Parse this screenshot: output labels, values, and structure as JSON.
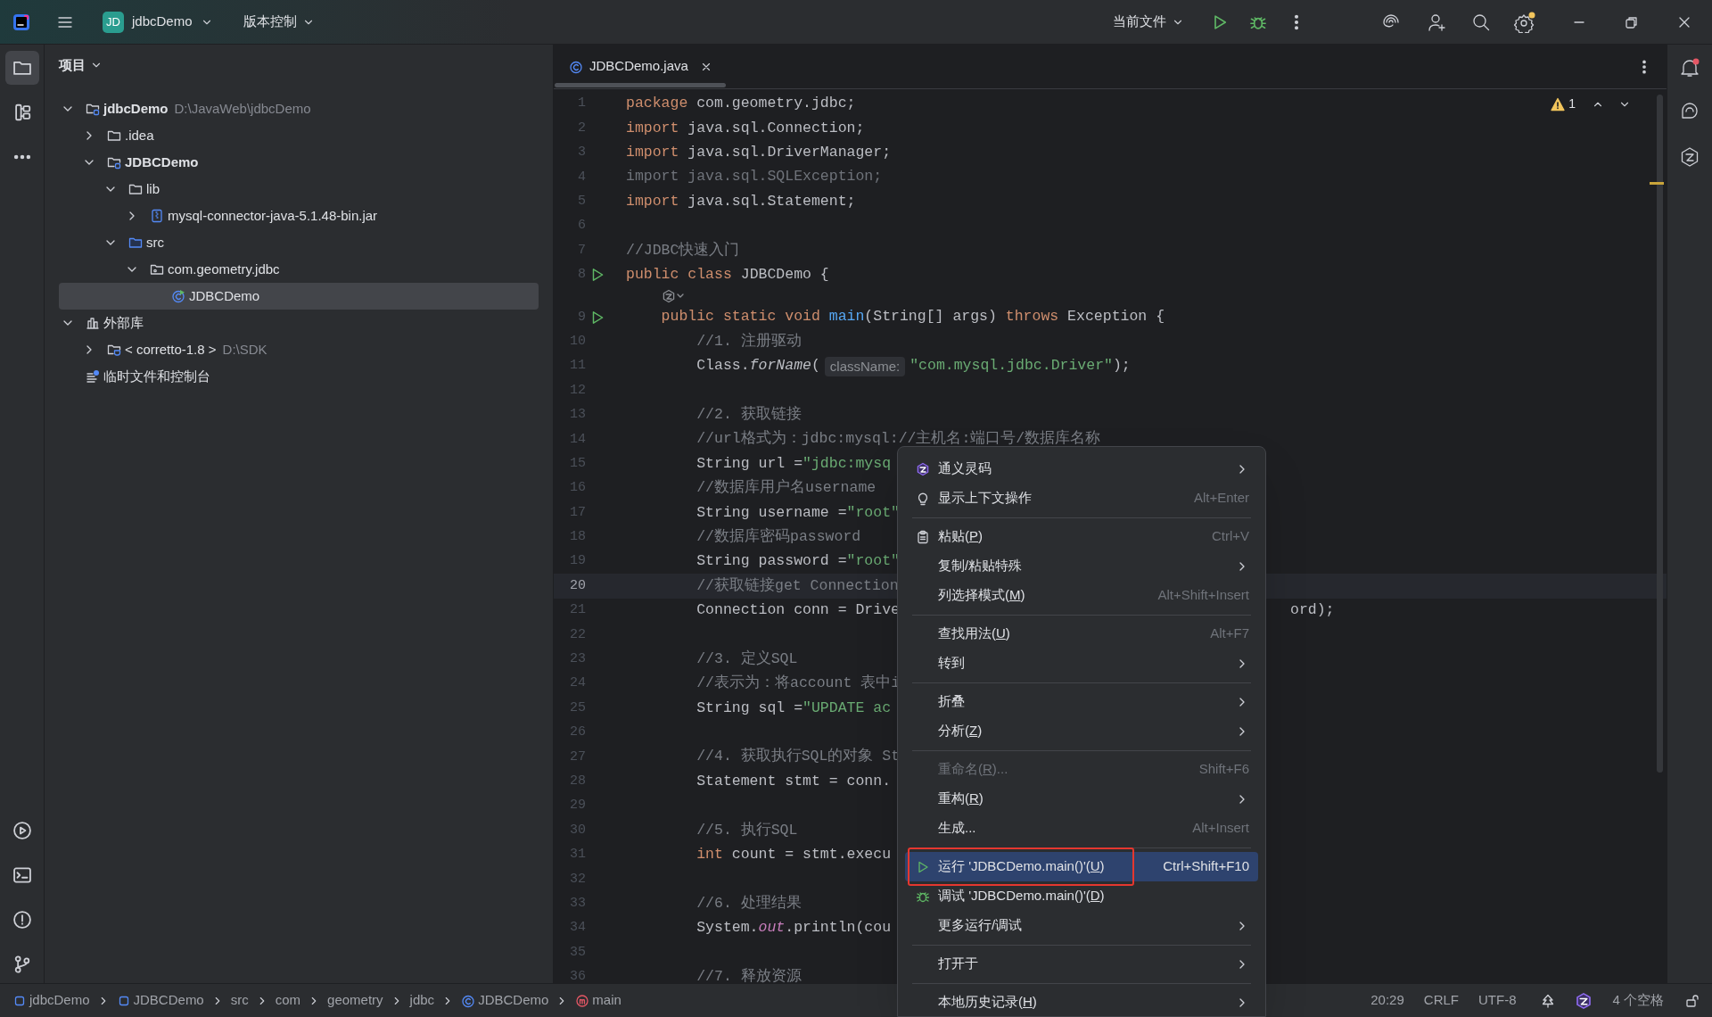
{
  "title_bar": {
    "project": {
      "badge": "JD",
      "name": "jdbcDemo"
    },
    "vcs": "版本控制",
    "run_config": "当前文件"
  },
  "left_toolbar": {
    "tools": [
      {
        "selected": true
      },
      {
        "selected": false
      }
    ]
  },
  "project_panel": {
    "title": "项目",
    "tree": [
      {
        "kind": "module",
        "label": "jdbcDemo",
        "hint": "D:\\JavaWeb\\jdbcDemo",
        "expanded": true,
        "selected": false,
        "children": [
          {
            "kind": "folder",
            "label": ".idea",
            "expanded": false,
            "selected": false
          },
          {
            "kind": "module",
            "label": "JDBCDemo",
            "expanded": true,
            "selected": false,
            "children": [
              {
                "kind": "folder",
                "label": "lib",
                "expanded": true,
                "selected": false,
                "children": [
                  {
                    "kind": "jar",
                    "label": "mysql-connector-java-5.1.48-bin.jar",
                    "expanded": false,
                    "selected": false
                  }
                ]
              },
              {
                "kind": "src",
                "label": "src",
                "expanded": true,
                "selected": false,
                "children": [
                  {
                    "kind": "package",
                    "label": "com.geometry.jdbc",
                    "expanded": true,
                    "selected": false,
                    "children": [
                      {
                        "kind": "class",
                        "label": "JDBCDemo",
                        "selected": true
                      }
                    ]
                  }
                ]
              }
            ]
          }
        ]
      },
      {
        "kind": "library",
        "label": "外部库",
        "expanded": true,
        "selected": false,
        "children": [
          {
            "kind": "sdk",
            "label": "< corretto-1.8 >",
            "hint": "D:\\SDK",
            "expanded": false,
            "selected": false
          }
        ]
      },
      {
        "kind": "scratch",
        "label": "临时文件和控制台",
        "selected": false
      }
    ]
  },
  "editor": {
    "tabs": [
      {
        "label": "JDBCDemo.java",
        "selected": true
      }
    ],
    "warnings": "1",
    "lines": [
      {
        "kind": "code",
        "number": "1",
        "current": false,
        "run": false,
        "tokens": [
          {
            "kind": "kw",
            "text": "package"
          },
          {
            "kind": "plain",
            "text": " com.geometry.jdbc;"
          }
        ]
      },
      {
        "kind": "code",
        "number": "2",
        "current": false,
        "run": false,
        "tokens": [
          {
            "kind": "kw",
            "text": "import"
          },
          {
            "kind": "plain",
            "text": " java.sql.Connection;"
          }
        ]
      },
      {
        "kind": "code",
        "number": "3",
        "current": false,
        "run": false,
        "tokens": [
          {
            "kind": "kw",
            "text": "import"
          },
          {
            "kind": "plain",
            "text": " java.sql.DriverManager;"
          }
        ]
      },
      {
        "kind": "code",
        "number": "4",
        "current": false,
        "run": false,
        "tokens": [
          {
            "kind": "unused",
            "text": "import java.sql.SQLException;"
          }
        ]
      },
      {
        "kind": "code",
        "number": "5",
        "current": false,
        "run": false,
        "tokens": [
          {
            "kind": "kw",
            "text": "import"
          },
          {
            "kind": "plain",
            "text": " java.sql.Statement;"
          }
        ]
      },
      {
        "kind": "code",
        "number": "6",
        "current": false,
        "run": false
      },
      {
        "kind": "code",
        "number": "7",
        "current": false,
        "run": false,
        "tokens": [
          {
            "kind": "comment",
            "text": "//JDBC快速入门"
          }
        ]
      },
      {
        "kind": "code",
        "number": "8",
        "current": false,
        "run": true,
        "tokens": [
          {
            "kind": "kw",
            "text": "public class"
          },
          {
            "kind": "plain",
            "text": " JDBCDemo {"
          }
        ]
      },
      {
        "kind": "inlay"
      },
      {
        "kind": "code",
        "number": "9",
        "current": false,
        "run": true,
        "tokens": [
          {
            "kind": "kw",
            "text": "    public static void "
          },
          {
            "kind": "fn",
            "text": "main"
          },
          {
            "kind": "plain",
            "text": "(String[] args) "
          },
          {
            "kind": "kw",
            "text": "throws"
          },
          {
            "kind": "plain",
            "text": " Exception {"
          }
        ]
      },
      {
        "kind": "code",
        "number": "10",
        "current": false,
        "run": false,
        "tokens": [
          {
            "kind": "comment",
            "text": "        //1. 注册驱动"
          }
        ]
      },
      {
        "kind": "code",
        "number": "11",
        "current": false,
        "run": false,
        "tokens": [
          {
            "kind": "plain",
            "text": "        Class."
          },
          {
            "kind": "static",
            "text": "forName"
          },
          {
            "kind": "plain",
            "text": "("
          },
          {
            "kind": "hint",
            "text": "className:"
          },
          {
            "kind": "str",
            "text": "\"com.mysql.jdbc.Driver\""
          },
          {
            "kind": "plain",
            "text": ");"
          }
        ]
      },
      {
        "kind": "code",
        "number": "12",
        "current": false,
        "run": false
      },
      {
        "kind": "code",
        "number": "13",
        "current": false,
        "run": false,
        "tokens": [
          {
            "kind": "comment",
            "text": "        //2. 获取链接"
          }
        ]
      },
      {
        "kind": "code",
        "number": "14",
        "current": false,
        "run": false,
        "tokens": [
          {
            "kind": "comment",
            "text": "        //url格式为：jdbc:mysql://主机名:端口号/数据库名称"
          }
        ]
      },
      {
        "kind": "code",
        "number": "15",
        "current": false,
        "run": false,
        "tokens": [
          {
            "kind": "plain",
            "text": "        String url ="
          },
          {
            "kind": "str",
            "text": "\"jdbc:mysq"
          }
        ]
      },
      {
        "kind": "code",
        "number": "16",
        "current": false,
        "run": false,
        "tokens": [
          {
            "kind": "comment",
            "text": "        //数据库用户名username"
          }
        ]
      },
      {
        "kind": "code",
        "number": "17",
        "current": false,
        "run": false,
        "tokens": [
          {
            "kind": "plain",
            "text": "        String username ="
          },
          {
            "kind": "str",
            "text": "\"root\""
          }
        ]
      },
      {
        "kind": "code",
        "number": "18",
        "current": false,
        "run": false,
        "tokens": [
          {
            "kind": "comment",
            "text": "        //数据库密码password"
          }
        ]
      },
      {
        "kind": "code",
        "number": "19",
        "current": false,
        "run": false,
        "tokens": [
          {
            "kind": "plain",
            "text": "        String password ="
          },
          {
            "kind": "str",
            "text": "\"root\""
          }
        ]
      },
      {
        "kind": "code",
        "number": "20",
        "current": true,
        "run": false,
        "tokens": [
          {
            "kind": "comment",
            "text": "        //获取链接get Connection"
          }
        ]
      },
      {
        "kind": "code",
        "number": "21",
        "current": false,
        "run": false,
        "tokens": [
          {
            "kind": "plain",
            "text": "        Connection conn = Drive"
          }
        ],
        "tail": "ord);"
      },
      {
        "kind": "code",
        "number": "22",
        "current": false,
        "run": false
      },
      {
        "kind": "code",
        "number": "23",
        "current": false,
        "run": false,
        "tokens": [
          {
            "kind": "comment",
            "text": "        //3. 定义SQL"
          }
        ]
      },
      {
        "kind": "code",
        "number": "24",
        "current": false,
        "run": false,
        "tokens": [
          {
            "kind": "comment",
            "text": "        //表示为：将account 表中i"
          }
        ]
      },
      {
        "kind": "code",
        "number": "25",
        "current": false,
        "run": false,
        "tokens": [
          {
            "kind": "plain",
            "text": "        String sql ="
          },
          {
            "kind": "str",
            "text": "\"UPDATE ac"
          }
        ]
      },
      {
        "kind": "code",
        "number": "26",
        "current": false,
        "run": false
      },
      {
        "kind": "code",
        "number": "27",
        "current": false,
        "run": false,
        "tokens": [
          {
            "kind": "comment",
            "text": "        //4. 获取执行SQL的对象 St"
          }
        ]
      },
      {
        "kind": "code",
        "number": "28",
        "current": false,
        "run": false,
        "tokens": [
          {
            "kind": "plain",
            "text": "        Statement stmt = conn."
          }
        ]
      },
      {
        "kind": "code",
        "number": "29",
        "current": false,
        "run": false
      },
      {
        "kind": "code",
        "number": "30",
        "current": false,
        "run": false,
        "tokens": [
          {
            "kind": "comment",
            "text": "        //5. 执行SQL"
          }
        ]
      },
      {
        "kind": "code",
        "number": "31",
        "current": false,
        "run": false,
        "tokens": [
          {
            "kind": "kw",
            "text": "        int"
          },
          {
            "kind": "plain",
            "text": " count = stmt.execu"
          }
        ]
      },
      {
        "kind": "code",
        "number": "32",
        "current": false,
        "run": false
      },
      {
        "kind": "code",
        "number": "33",
        "current": false,
        "run": false,
        "tokens": [
          {
            "kind": "comment",
            "text": "        //6. 处理结果"
          }
        ]
      },
      {
        "kind": "code",
        "number": "34",
        "current": false,
        "run": false,
        "tokens": [
          {
            "kind": "plain",
            "text": "        System."
          },
          {
            "kind": "field",
            "text": "out"
          },
          {
            "kind": "plain",
            "text": ".println(cou"
          }
        ]
      },
      {
        "kind": "code",
        "number": "35",
        "current": false,
        "run": false
      },
      {
        "kind": "code",
        "number": "36",
        "current": false,
        "run": false,
        "tokens": [
          {
            "kind": "comment",
            "text": "        //7. 释放资源"
          }
        ]
      }
    ]
  },
  "context_menu": {
    "groups": [
      [
        {
          "label": "通义灵码",
          "submenu": true,
          "disabled": false,
          "selected": false,
          "framed": false
        },
        {
          "label": "显示上下文操作",
          "shortcut": "Alt+Enter",
          "submenu": false,
          "disabled": false,
          "selected": false,
          "framed": false
        }
      ],
      [
        {
          "label": "粘贴(P)",
          "shortcut": "Ctrl+V",
          "submenu": false,
          "disabled": false,
          "selected": false,
          "framed": false
        },
        {
          "label": "复制/粘贴特殊",
          "submenu": true,
          "disabled": false,
          "selected": false,
          "framed": false
        },
        {
          "label": "列选择模式(M)",
          "shortcut": "Alt+Shift+Insert",
          "submenu": false,
          "disabled": false,
          "selected": false,
          "framed": false
        }
      ],
      [
        {
          "label": "查找用法(U)",
          "shortcut": "Alt+F7",
          "submenu": false,
          "disabled": false,
          "selected": false,
          "framed": false
        },
        {
          "label": "转到",
          "submenu": true,
          "disabled": false,
          "selected": false,
          "framed": false
        }
      ],
      [
        {
          "label": "折叠",
          "submenu": true,
          "disabled": false,
          "selected": false,
          "framed": false
        },
        {
          "label": "分析(Z)",
          "submenu": true,
          "disabled": false,
          "selected": false,
          "framed": false
        }
      ],
      [
        {
          "label": "重命名(R)...",
          "shortcut": "Shift+F6",
          "submenu": false,
          "disabled": true,
          "selected": false,
          "framed": false
        },
        {
          "label": "重构(R)",
          "submenu": true,
          "disabled": false,
          "selected": false,
          "framed": false
        },
        {
          "label": "生成...",
          "shortcut": "Alt+Insert",
          "submenu": false,
          "disabled": false,
          "selected": false,
          "framed": false
        }
      ],
      [
        {
          "label": "运行 'JDBCDemo.main()'(U)",
          "shortcut": "Ctrl+Shift+F10",
          "submenu": false,
          "disabled": false,
          "selected": true,
          "framed": true
        },
        {
          "label": "调试 'JDBCDemo.main()'(D)",
          "submenu": false,
          "disabled": false,
          "selected": false,
          "framed": false
        },
        {
          "label": "更多运行/调试",
          "submenu": true,
          "disabled": false,
          "selected": false,
          "framed": false
        }
      ],
      [
        {
          "label": "打开于",
          "submenu": true,
          "disabled": false,
          "selected": false,
          "framed": false
        }
      ],
      [
        {
          "label": "本地历史记录(H)",
          "submenu": true,
          "disabled": false,
          "selected": false,
          "framed": false
        }
      ]
    ]
  },
  "status_bar": {
    "breadcrumbs": [
      {
        "kind": "module",
        "text": "jdbcDemo"
      },
      {
        "kind": "module",
        "text": "JDBCDemo"
      },
      {
        "kind": "plain",
        "text": "src"
      },
      {
        "kind": "plain",
        "text": "com"
      },
      {
        "kind": "plain",
        "text": "geometry"
      },
      {
        "kind": "plain",
        "text": "jdbc"
      },
      {
        "kind": "class",
        "text": "JDBCDemo"
      },
      {
        "kind": "method",
        "text": "main"
      }
    ],
    "position": "20:29",
    "line_separator": "CRLF",
    "encoding": "UTF-8",
    "indent": "4 个空格"
  }
}
